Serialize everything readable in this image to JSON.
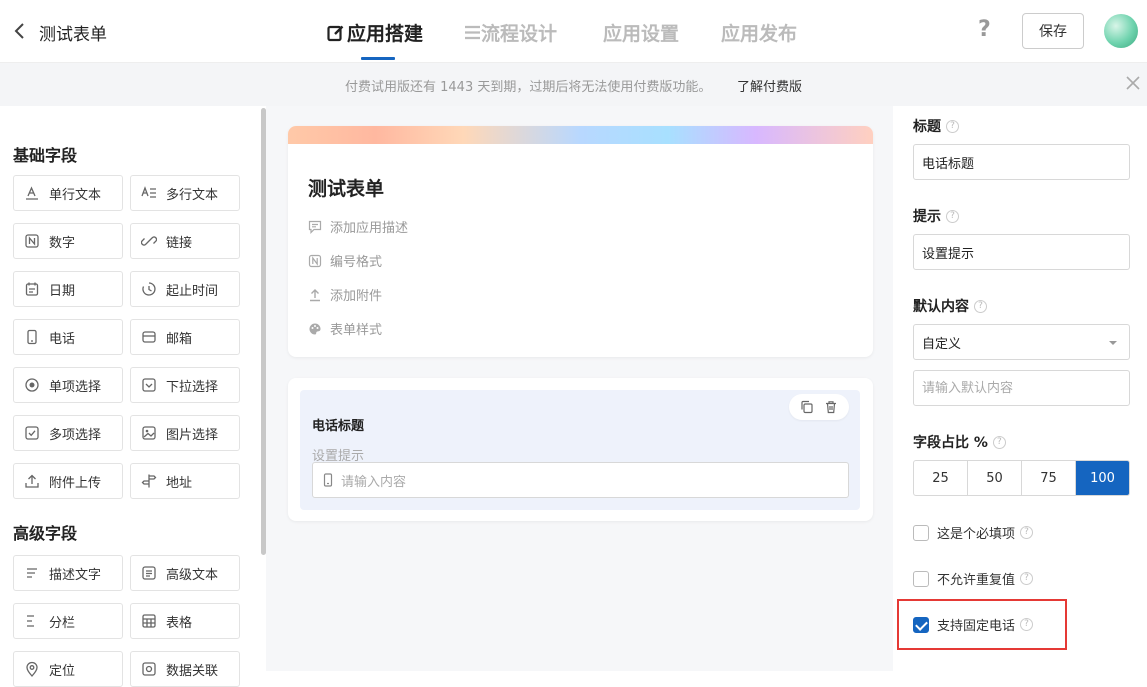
{
  "header": {
    "app_title": "测试表单",
    "tabs": [
      {
        "label": "应用搭建",
        "active": true
      },
      {
        "label": "流程设计",
        "active": false
      },
      {
        "label": "应用设置",
        "active": false
      },
      {
        "label": "应用发布",
        "active": false
      }
    ],
    "help": "?",
    "save_label": "保存"
  },
  "notice": {
    "text": "付费试用版还有 1443 天到期，过期后将无法使用付费版功能。",
    "link": "了解付费版"
  },
  "palette": {
    "basic_title": "基础字段",
    "basic": [
      {
        "label": "单行文本",
        "icon": "text-icon"
      },
      {
        "label": "多行文本",
        "icon": "multiline-text-icon"
      },
      {
        "label": "数字",
        "icon": "number-icon"
      },
      {
        "label": "链接",
        "icon": "link-icon"
      },
      {
        "label": "日期",
        "icon": "calendar-icon"
      },
      {
        "label": "起止时间",
        "icon": "clock-icon"
      },
      {
        "label": "电话",
        "icon": "phone-icon"
      },
      {
        "label": "邮箱",
        "icon": "mail-icon"
      },
      {
        "label": "单项选择",
        "icon": "radio-icon"
      },
      {
        "label": "下拉选择",
        "icon": "dropdown-icon"
      },
      {
        "label": "多项选择",
        "icon": "checkbox-icon"
      },
      {
        "label": "图片选择",
        "icon": "image-icon"
      },
      {
        "label": "附件上传",
        "icon": "upload-icon"
      },
      {
        "label": "地址",
        "icon": "address-icon"
      }
    ],
    "advanced_title": "高级字段",
    "advanced": [
      {
        "label": "描述文字",
        "icon": "description-icon"
      },
      {
        "label": "高级文本",
        "icon": "rich-text-icon"
      },
      {
        "label": "分栏",
        "icon": "columns-icon"
      },
      {
        "label": "表格",
        "icon": "table-icon"
      },
      {
        "label": "定位",
        "icon": "location-icon"
      },
      {
        "label": "数据关联",
        "icon": "data-link-icon"
      }
    ]
  },
  "form": {
    "title": "测试表单",
    "meta": [
      {
        "label": "添加应用描述",
        "icon": "comment-icon"
      },
      {
        "label": "编号格式",
        "icon": "number-format-icon"
      },
      {
        "label": "添加附件",
        "icon": "attachment-icon"
      },
      {
        "label": "表单样式",
        "icon": "palette-icon"
      }
    ],
    "field": {
      "label": "电话标题",
      "hint": "设置提示",
      "placeholder": "请输入内容"
    }
  },
  "props": {
    "title_label": "标题",
    "title_value": "电话标题",
    "hint_label": "提示",
    "hint_value": "设置提示",
    "default_label": "默认内容",
    "default_select": "自定义",
    "default_placeholder": "请输入默认内容",
    "width_label": "字段占比 %",
    "width_options": [
      "25",
      "50",
      "75",
      "100"
    ],
    "width_selected": "100",
    "checkboxes": [
      {
        "label": "这是个必填项",
        "checked": false
      },
      {
        "label": "不允许重复值",
        "checked": false
      },
      {
        "label": "支持固定电话",
        "checked": true
      }
    ]
  },
  "colors": {
    "accent": "#1565c0",
    "highlight": "#e53935"
  }
}
